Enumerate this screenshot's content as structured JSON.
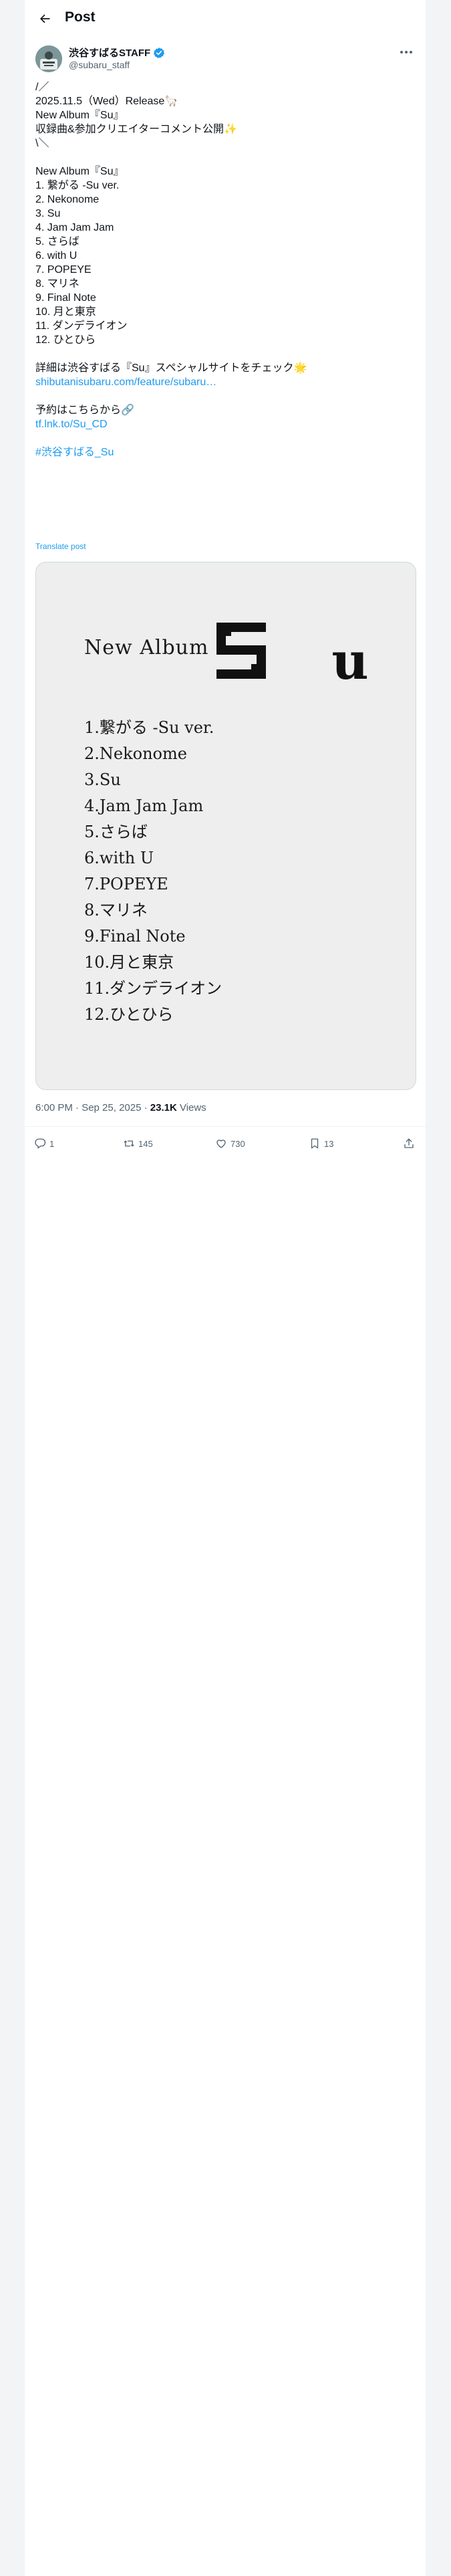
{
  "header": {
    "title": "Post"
  },
  "author": {
    "display_name": "渋谷すばるSTAFF",
    "handle": "@subaru_staff",
    "verified": true
  },
  "post": {
    "lines": [
      {
        "text": "/／"
      },
      {
        "text": "2025.11.5（Wed）Release🦙"
      },
      {
        "text": "New Album『Su』"
      },
      {
        "text": "収録曲&参加クリエイターコメント公開✨"
      },
      {
        "text": "\\＼"
      },
      {
        "text": ""
      },
      {
        "text": "New Album『Su』"
      },
      {
        "text": "1. 繋がる -Su ver."
      },
      {
        "text": "2. Nekonome"
      },
      {
        "text": "3. Su"
      },
      {
        "text": "4. Jam Jam Jam"
      },
      {
        "text": "5. さらば"
      },
      {
        "text": "6. with U"
      },
      {
        "text": "7. POPEYE"
      },
      {
        "text": "8. マリネ"
      },
      {
        "text": "9. Final Note"
      },
      {
        "text": "10. 月と東京"
      },
      {
        "text": "11. ダンデライオン"
      },
      {
        "text": "12. ひとひら"
      },
      {
        "text": ""
      },
      {
        "text": "詳細は渋谷すばる『Su』スペシャルサイトをチェック🌟"
      },
      {
        "text": "shibutanisubaru.com/feature/subaru…",
        "link": true
      },
      {
        "text": ""
      },
      {
        "text": "予約はこちらから🔗"
      },
      {
        "text": "tf.lnk.to/Su_CD",
        "link": true
      },
      {
        "text": ""
      },
      {
        "text": "#渋谷すばる_Su",
        "link": true
      }
    ],
    "translate_label": "Translate post"
  },
  "media": {
    "album_label": "New Album",
    "logo_text": "Su",
    "tracks": [
      "1.繋がる -Su ver.",
      "2.Nekonome",
      "3.Su",
      "4.Jam Jam Jam",
      "5.さらば",
      "6.with U",
      "7.POPEYE",
      "8.マリネ",
      "9.Final Note",
      "10.月と東京",
      "11.ダンデライオン",
      "12.ひとひら"
    ]
  },
  "meta": {
    "time_date": "6:00 PM · Sep 25, 2025 · ",
    "views_count": "23.1K",
    "views_label": " Views"
  },
  "actions": {
    "replies": "1",
    "reposts": "145",
    "likes": "730",
    "bookmarks": "13"
  },
  "colors": {
    "accent": "#1d9bf0",
    "text": "#0f1419",
    "muted": "#536471",
    "page_background": "#f2f4f5"
  },
  "icons": [
    "back-arrow-icon",
    "verified-badge-icon",
    "more-icon",
    "reply-icon",
    "repost-icon",
    "like-icon",
    "bookmark-icon",
    "share-icon"
  ]
}
